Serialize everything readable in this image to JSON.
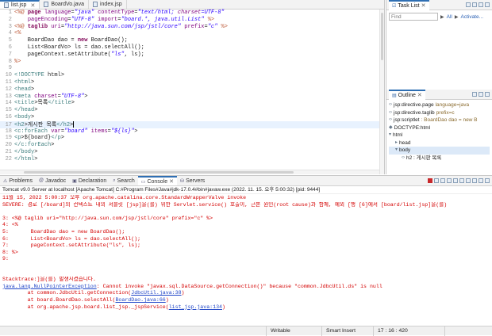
{
  "editor": {
    "tabs": [
      {
        "label": "list.jsp",
        "active": true
      },
      {
        "label": "BoardVo.java",
        "active": false
      },
      {
        "label": "index.jsp",
        "active": false
      }
    ],
    "lines": [
      {
        "num": "1",
        "text": "<%@ page language=\"java\" contentType=\"text/html; charset=UTF-8\""
      },
      {
        "num": "2",
        "text": "    pageEncoding=\"UTF-8\" import=\"board.*, java.util.List\" %>"
      },
      {
        "num": "3",
        "text": "<%@ taglib uri=\"http://java.sun.com/jsp/jstl/core\" prefix=\"c\" %>"
      },
      {
        "num": "4",
        "text": "<%"
      },
      {
        "num": "5",
        "text": "    BoardDao dao = new BoardDao();"
      },
      {
        "num": "6",
        "text": "    List<BoardVo> ls = dao.selectAll();"
      },
      {
        "num": "7",
        "text": "    pageContext.setAttribute(\"ls\", ls);"
      },
      {
        "num": "8",
        "text": "%>"
      },
      {
        "num": "9",
        "text": ""
      },
      {
        "num": "10",
        "text": "<!DOCTYPE html>"
      },
      {
        "num": "11",
        "text": "<html>"
      },
      {
        "num": "12",
        "text": "<head>"
      },
      {
        "num": "13",
        "text": "<meta charset=\"UTF-8\">"
      },
      {
        "num": "14",
        "text": "<title>목록</title>"
      },
      {
        "num": "15",
        "text": "</head>"
      },
      {
        "num": "16",
        "text": "<body>"
      },
      {
        "num": "17",
        "text": "<h2>게시판 목록</h2>"
      },
      {
        "num": "18",
        "text": "<c:forEach var=\"board\" items=\"${ls}\">"
      },
      {
        "num": "19",
        "text": "<p>${board}</p>"
      },
      {
        "num": "20",
        "text": "</c:forEach>"
      },
      {
        "num": "21",
        "text": "</body>"
      },
      {
        "num": "22",
        "text": "</html>"
      }
    ],
    "current_line": "17"
  },
  "task_list": {
    "title": "Task List",
    "find_placeholder": "Find",
    "all_label": "All",
    "activate_label": "Activate..."
  },
  "outline": {
    "title": "Outline",
    "nodes": [
      {
        "label": "jsp:directive.page",
        "sub": "language=java",
        "indent": 0,
        "icon": "<>"
      },
      {
        "label": "jsp:directive.taglib",
        "sub": "prefix=c",
        "indent": 0,
        "icon": "<>"
      },
      {
        "label": "jsp:scriptlet",
        "sub": ": BoardDao dao = new B",
        "indent": 0,
        "icon": "<>"
      },
      {
        "label": "DOCTYPE:html",
        "sub": "",
        "indent": 0,
        "icon": "D"
      },
      {
        "label": "html",
        "sub": "",
        "indent": 0,
        "icon": "v"
      },
      {
        "label": "head",
        "sub": "",
        "indent": 1,
        "icon": ">"
      },
      {
        "label": "body",
        "sub": "",
        "indent": 1,
        "icon": "v"
      },
      {
        "label": "h2 : 게시판 목록",
        "sub": "",
        "indent": 2,
        "icon": "<>"
      }
    ]
  },
  "console": {
    "tabs": [
      {
        "label": "Problems",
        "active": false
      },
      {
        "label": "Javadoc",
        "active": false
      },
      {
        "label": "Declaration",
        "active": false
      },
      {
        "label": "Search",
        "active": false
      },
      {
        "label": "Console",
        "active": true
      },
      {
        "label": "Servers",
        "active": false
      }
    ],
    "description": "Tomcat v9.0 Server at localhost [Apache Tomcat] C:#Program Files#Java#jdk-17.0.4#bin#javaw.exe  (2022. 11. 15. 오후 5:00:32) [pid: 9444]",
    "lines": [
      "11월 15, 2022 5:00:37 오후 org.apache.catalina.core.StandardWrapperValve invoke",
      "SEVERE: 경로 [/board]의 컨텍스트 내의 서블릿 [jsp]을(를) 위한 Servlet.service() 호출이, 근본 원인(root cause)과 함께, 예외 [행 [6]에서 [board/list.jsp]을(를)",
      "",
      "3: <%@ taglib uri=\"http://java.sun.com/jsp/jstl/core\" prefix=\"c\" %>",
      "4: <%",
      "5:       BoardDao dao = new BoardDao();",
      "6:       List<BoardVo> ls = dao.selectAll();",
      "7:       pageContext.setAttribute(\"ls\", ls);",
      "8: %>",
      "9:",
      "",
      "",
      "Stacktrace:]을(를) 발생시켰습니다."
    ],
    "exception_class": "java.lang.NullPointerException",
    "exception_msg": ": Cannot invoke \"javax.sql.DataSource.getConnection()\" because \"common.JdbcUtil.ds\" is null",
    "stack": [
      {
        "prefix": "        at common.JdbcUtil.getConnection(",
        "link": "JdbcUtil.java:38",
        "suffix": ")"
      },
      {
        "prefix": "        at board.BoardDao.selectAll(",
        "link": "BoardDao.java:66",
        "suffix": ")"
      },
      {
        "prefix": "        at org.apache.jsp.board.list_jsp._jspService(",
        "link": "list_jsp.java:134",
        "suffix": ")"
      }
    ]
  },
  "statusbar": {
    "mode": "Writable",
    "insert": "Smart Insert",
    "position": "17 : 16 : 420"
  }
}
